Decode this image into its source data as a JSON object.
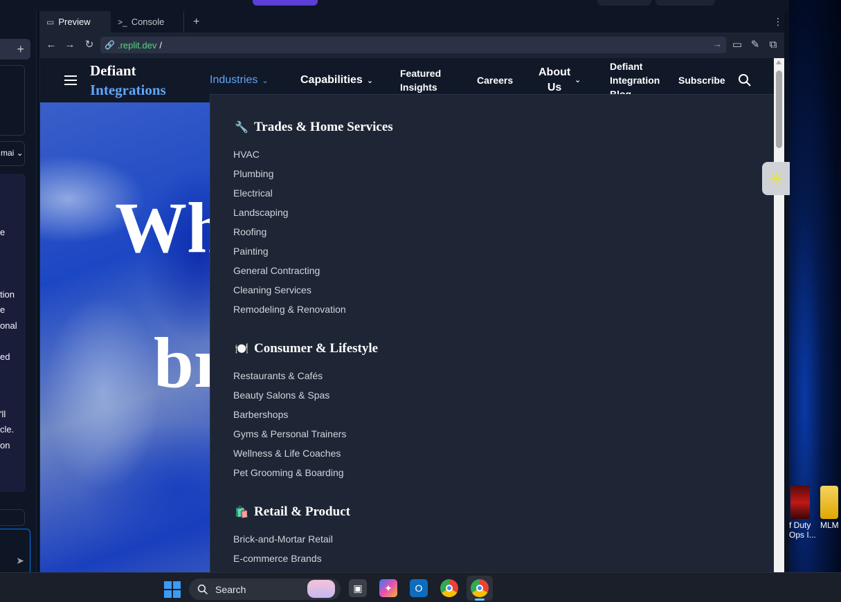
{
  "tabs": {
    "preview": "Preview",
    "console": "Console",
    "console_icon": ">_",
    "add": "+"
  },
  "url": {
    "domain": ".replit.dev",
    "path": "/"
  },
  "left_panel": {
    "snippets": [
      "mai",
      "e",
      "tion",
      "e",
      "onal",
      "ed",
      "'ll",
      "cle.",
      "on"
    ],
    "plus": "+"
  },
  "site": {
    "brand_line1": "Defiant",
    "brand_line2": "Integrations",
    "nav": {
      "industries": "Industries",
      "capabilities": "Capabilities",
      "featured_1": "Featured",
      "featured_2": "Insights",
      "careers": "Careers",
      "about_1": "About",
      "about_2": "Us",
      "blog_1": "Defiant",
      "blog_2": "Integration",
      "blog_3": "Blog",
      "subscribe": "Subscribe"
    },
    "hero": {
      "line1": "Wh",
      "line2": "br"
    }
  },
  "dropdown": {
    "categories": [
      {
        "icon": "🔧",
        "title": "Trades & Home Services",
        "items": [
          "HVAC",
          "Plumbing",
          "Electrical",
          "Landscaping",
          "Roofing",
          "Painting",
          "General Contracting",
          "Cleaning Services",
          "Remodeling & Renovation"
        ]
      },
      {
        "icon": "🍽️",
        "title": "Consumer & Lifestyle",
        "items": [
          "Restaurants & Cafés",
          "Beauty Salons & Spas",
          "Barbershops",
          "Gyms & Personal Trainers",
          "Wellness & Life Coaches",
          "Pet Grooming & Boarding"
        ]
      },
      {
        "icon": "🛍️",
        "title": "Retail & Product",
        "items": [
          "Brick-and-Mortar Retail",
          "E-commerce Brands"
        ]
      }
    ]
  },
  "desktop": {
    "icon1_1": "f Duty",
    "icon1_2": "Ops I...",
    "icon2": "MLM"
  },
  "taskbar": {
    "search_label": "Search"
  },
  "colors": {
    "accent": "#60a5fa",
    "nav_bg": "#111827",
    "dropdown_bg": "#1e2535"
  }
}
